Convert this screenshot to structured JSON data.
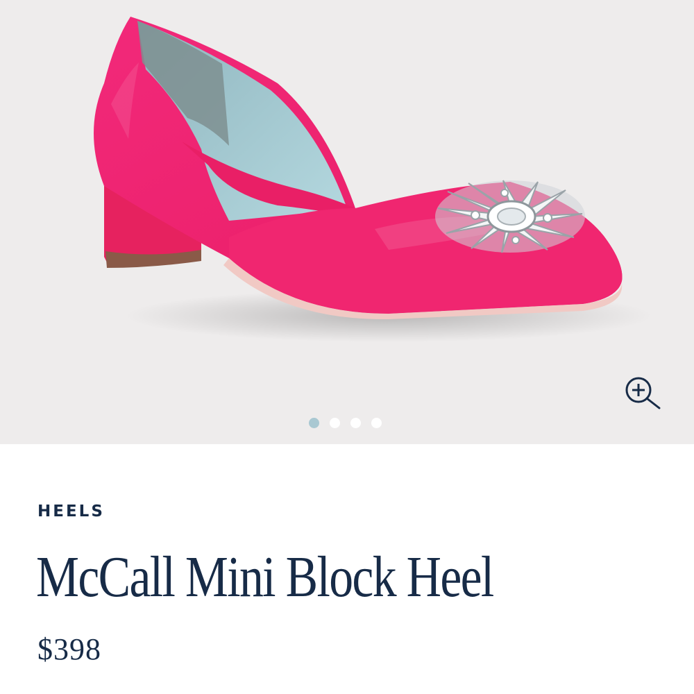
{
  "product": {
    "category": "HEELS",
    "title": "McCall Mini Block Heel",
    "price": "$398"
  },
  "gallery": {
    "image_count": 4,
    "active_index": 0,
    "zoom_icon": "zoom-in-icon"
  },
  "colors": {
    "gallery_background": "#eeecec",
    "shoe_pink": "#f1246f",
    "lining_blue": "#a7cdd5",
    "text_navy": "#172b47",
    "dot_active": "#a9c8d2",
    "dot_inactive": "#ffffff"
  }
}
